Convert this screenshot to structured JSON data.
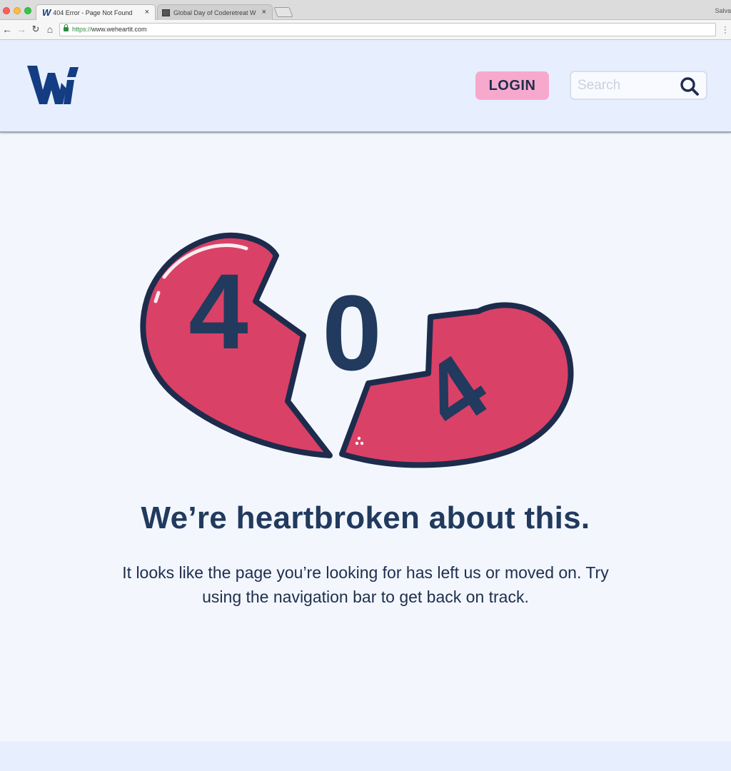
{
  "browser": {
    "tabs": [
      {
        "label": "404 Error - Page Not Found",
        "active": true,
        "favicon": "weheartit-logo-icon"
      },
      {
        "label": "Global Day of Coderetreat W",
        "active": false,
        "favicon": "page-icon"
      }
    ],
    "close_glyph": "×",
    "profile_name": "Salva",
    "url_scheme": "https://",
    "url_host": "www.weheartit.com",
    "nav": {
      "back": "←",
      "forward": "→",
      "reload": "↻",
      "home": "⌂"
    }
  },
  "header": {
    "logo_icon": "weheartit-logo",
    "login_label": "LOGIN",
    "search_placeholder": "Search",
    "search_icon": "search-icon"
  },
  "error": {
    "digits": [
      "4",
      "0",
      "4"
    ],
    "headline": "We’re heartbroken about this.",
    "message": "It looks like the page you’re looking for has left us or moved on. Try using the navigation bar to get back on track."
  },
  "colors": {
    "heart": "#da4166",
    "outline": "#1d2c4c",
    "digit": "#213a5e",
    "login_bg": "#f7a9cd",
    "header_bg": "#e7efff",
    "page_bg": "#f3f7fd",
    "logo": "#143c82"
  }
}
